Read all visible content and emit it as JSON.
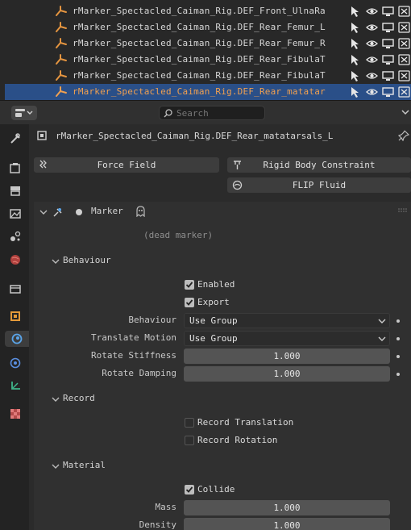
{
  "outliner": {
    "rows": [
      {
        "name": "rMarker_Spectacled_Caiman_Rig.DEF_Front_UlnaRa",
        "selected": false
      },
      {
        "name": "rMarker_Spectacled_Caiman_Rig.DEF_Rear_Femur_L",
        "selected": false
      },
      {
        "name": "rMarker_Spectacled_Caiman_Rig.DEF_Rear_Femur_R",
        "selected": false
      },
      {
        "name": "rMarker_Spectacled_Caiman_Rig.DEF_Rear_FibulaT",
        "selected": false
      },
      {
        "name": "rMarker_Spectacled_Caiman_Rig.DEF_Rear_FibulaT",
        "selected": false
      },
      {
        "name": "rMarker_Spectacled_Caiman_Rig.DEF_Rear_matatar",
        "selected": true
      }
    ],
    "icons": [
      "select-arrow-icon",
      "eye-icon",
      "monitor-icon",
      "camera-icon"
    ]
  },
  "header": {
    "search_placeholder": "Search"
  },
  "tabs": [
    "tool-icon",
    "render-icon",
    "output-icon",
    "view-layer-icon",
    "scene-icon",
    "world-icon",
    "collection-icon",
    "object-icon",
    "physics-icon",
    "constraints-icon",
    "data-icon",
    "texture-icon"
  ],
  "properties": {
    "object_name": "rMarker_Spectacled_Caiman_Rig.DEF_Rear_matatarsals_L",
    "buttons": {
      "force_field": "Force Field",
      "rigid_body_constraint": "Rigid Body Constraint",
      "flip_fluid": "FLIP Fluid"
    },
    "marker_panel": {
      "title": "Marker",
      "status": "(dead marker)"
    },
    "behaviour": {
      "title": "Behaviour",
      "enabled_label": "Enabled",
      "enabled": true,
      "export_label": "Export",
      "export": true,
      "behaviour_label": "Behaviour",
      "behaviour_value": "Use Group",
      "translate_motion_label": "Translate Motion",
      "translate_motion_value": "Use Group",
      "rotate_stiffness_label": "Rotate Stiffness",
      "rotate_stiffness_value": "1.000",
      "rotate_damping_label": "Rotate Damping",
      "rotate_damping_value": "1.000"
    },
    "record": {
      "title": "Record",
      "record_translation_label": "Record Translation",
      "record_translation": false,
      "record_rotation_label": "Record Rotation",
      "record_rotation": false
    },
    "material": {
      "title": "Material",
      "collide_label": "Collide",
      "collide": true,
      "mass_label": "Mass",
      "mass_value": "1.000",
      "density_label": "Density",
      "density_value": "1.000"
    }
  }
}
